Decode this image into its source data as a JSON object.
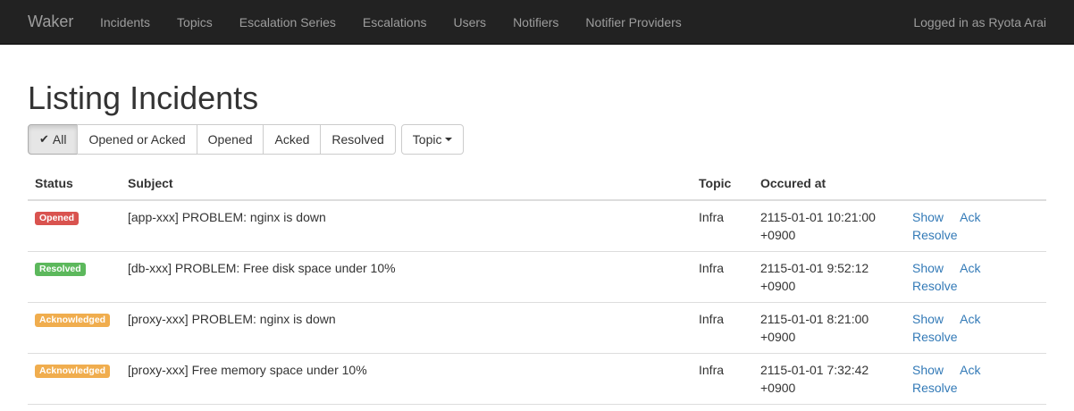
{
  "navbar": {
    "brand": "Waker",
    "links": [
      "Incidents",
      "Topics",
      "Escalation Series",
      "Escalations",
      "Users",
      "Notifiers",
      "Notifier Providers"
    ],
    "user_text": "Logged in as Ryota Arai"
  },
  "page": {
    "title": "Listing Incidents"
  },
  "filters": {
    "check_glyph": "✔",
    "buttons": [
      "All",
      "Opened or Acked",
      "Opened",
      "Acked",
      "Resolved"
    ],
    "active": "All",
    "topic_label": "Topic"
  },
  "table": {
    "headers": [
      "Status",
      "Subject",
      "Topic",
      "Occured at",
      ""
    ],
    "rows": [
      {
        "status": "Opened",
        "status_color": "#d9534f",
        "subject": "[app-xxx] PROBLEM: nginx is down",
        "topic": "Infra",
        "date": "2115-01-01 10:21:00",
        "tz": "+0900"
      },
      {
        "status": "Resolved",
        "status_color": "#5cb85c",
        "subject": "[db-xxx] PROBLEM: Free disk space under 10%",
        "topic": "Infra",
        "date": "2115-01-01 9:52:12",
        "tz": "+0900"
      },
      {
        "status": "Acknowledged",
        "status_color": "#f0ad4e",
        "subject": "[proxy-xxx] PROBLEM: nginx is down",
        "topic": "Infra",
        "date": "2115-01-01 8:21:00",
        "tz": "+0900"
      },
      {
        "status": "Acknowledged",
        "status_color": "#f0ad4e",
        "subject": "[proxy-xxx] Free memory space under 10%",
        "topic": "Infra",
        "date": "2115-01-01 7:32:42",
        "tz": "+0900"
      }
    ],
    "actions": [
      "Show",
      "Ack",
      "Resolve"
    ]
  },
  "colors": {
    "navbar_bg": "#222222",
    "nav_text": "#9d9d9d",
    "link": "#337ab7"
  }
}
